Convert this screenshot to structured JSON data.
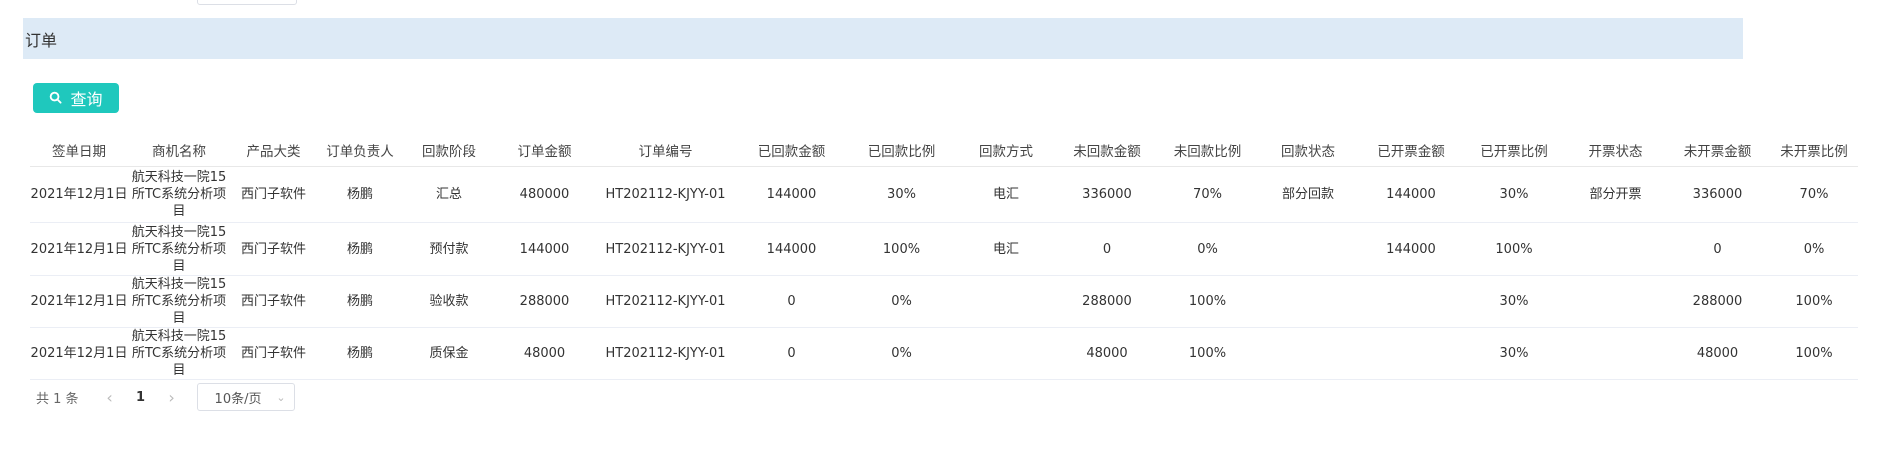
{
  "section": {
    "title": "订单"
  },
  "toolbar": {
    "query_label": "查询",
    "query_icon": "search-icon",
    "accent": "#1fc8bd"
  },
  "table": {
    "columns": [
      "签单日期",
      "商机名称",
      "产品大类",
      "订单负责人",
      "回款阶段",
      "订单金额",
      "订单编号",
      "已回款金额",
      "已回款比例",
      "回款方式",
      "未回款金额",
      "未回款比例",
      "回款状态",
      "已开票金额",
      "已开票比例",
      "开票状态",
      "未开票金额",
      "未开票比例"
    ],
    "rows": [
      [
        "2021年12月1日",
        "航天科技一院15所TC系统分析项目",
        "西门子软件",
        "杨鹏",
        "汇总",
        "480000",
        "HT202112-KJYY-01",
        "144000",
        "30%",
        "电汇",
        "336000",
        "70%",
        "部分回款",
        "144000",
        "30%",
        "部分开票",
        "336000",
        "70%"
      ],
      [
        "2021年12月1日",
        "航天科技一院15所TC系统分析项目",
        "西门子软件",
        "杨鹏",
        "预付款",
        "144000",
        "HT202112-KJYY-01",
        "144000",
        "100%",
        "电汇",
        "0",
        "0%",
        "",
        "144000",
        "100%",
        "",
        "0",
        "0%"
      ],
      [
        "2021年12月1日",
        "航天科技一院15所TC系统分析项目",
        "西门子软件",
        "杨鹏",
        "验收款",
        "288000",
        "HT202112-KJYY-01",
        "0",
        "0%",
        "",
        "288000",
        "100%",
        "",
        "",
        "30%",
        "",
        "288000",
        "100%"
      ],
      [
        "2021年12月1日",
        "航天科技一院15所TC系统分析项目",
        "西门子软件",
        "杨鹏",
        "质保金",
        "48000",
        "HT202112-KJYY-01",
        "0",
        "0%",
        "",
        "48000",
        "100%",
        "",
        "",
        "30%",
        "",
        "48000",
        "100%"
      ]
    ]
  },
  "pagination": {
    "total_label": "共 1 条",
    "prev_icon": "chevron-left-icon",
    "current_page": "1",
    "next_icon": "chevron-right-icon",
    "page_size": "10条/页",
    "page_size_icon": "chevron-down-icon"
  }
}
